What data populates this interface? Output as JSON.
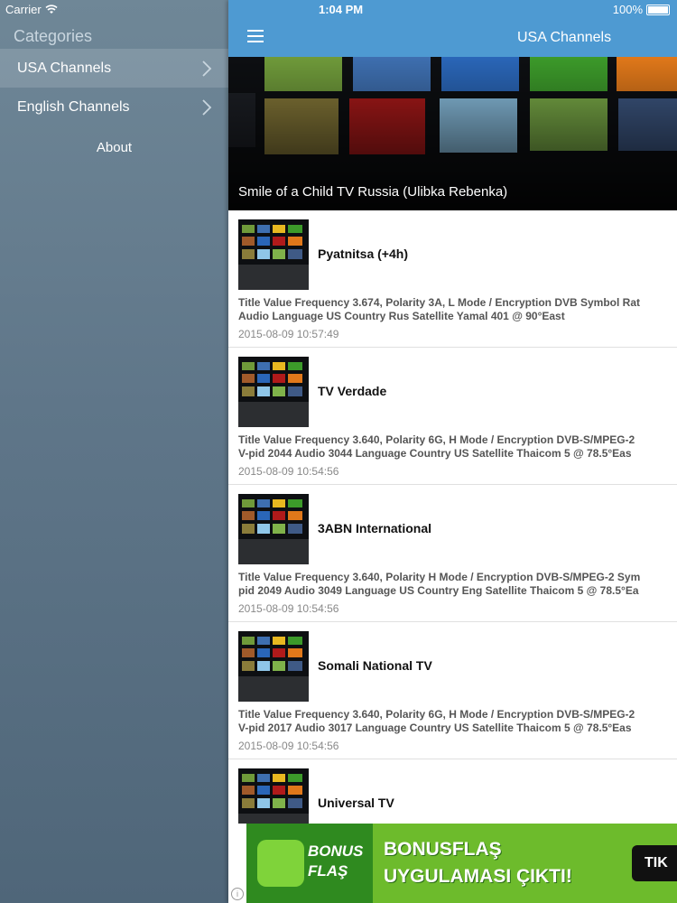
{
  "status": {
    "carrier": "Carrier",
    "time": "1:04 PM",
    "battery": "100%"
  },
  "sidebar": {
    "title": "Categories",
    "items": [
      {
        "label": "USA Channels",
        "selected": true
      },
      {
        "label": "English Channels",
        "selected": false
      }
    ],
    "about_label": "About"
  },
  "navbar": {
    "title": "USA Channels"
  },
  "hero": {
    "caption": "Smile of a Child TV Russia (Ulibka Rebenka)"
  },
  "channels": [
    {
      "title": "Pyatnitsa (+4h)",
      "desc_line1": "Title Value Frequency 3.674,  Polarity 3A, L Mode / Encryption DVB  Symbol Rat",
      "desc_line2": "Audio    Language US Country Rus Satellite Yamal 401 @ 90°East",
      "date": "2015-08-09 10:57:49"
    },
    {
      "title": "TV Verdade",
      "desc_line1": "Title Value Frequency 3.640,  Polarity 6G, H Mode / Encryption DVB-S/MPEG-2",
      "desc_line2": "V-pid 2044 Audio   3044 Language Country  US Satellite Thaicom 5 @ 78.5°Eas",
      "date": "2015-08-09 10:54:56"
    },
    {
      "title": "3ABN International",
      "desc_line1": "Title Value Frequency 3.640,  Polarity H Mode / Encryption DVB-S/MPEG-2  Sym",
      "desc_line2": "pid 2049 Audio   3049 Language US Country Eng Satellite Thaicom 5 @ 78.5°Ea",
      "date": "2015-08-09 10:54:56"
    },
    {
      "title": "Somali National TV",
      "desc_line1": "Title Value Frequency 3.640,  Polarity 6G, H Mode / Encryption DVB-S/MPEG-2",
      "desc_line2": "V-pid 2017 Audio   3017 Language Country  US Satellite Thaicom 5 @ 78.5°Eas",
      "date": "2015-08-09 10:54:56"
    },
    {
      "title": "Universal TV",
      "desc_line1": "",
      "desc_line2": "",
      "date": ""
    }
  ],
  "ad": {
    "logo_line1": "BONUS",
    "logo_line2": "FLAŞ",
    "text_line1": "BONUSFLAŞ",
    "text_line2": "UYGULAMASI ÇIKTI!",
    "button_label": "TIK",
    "info_icon": "i"
  },
  "colors": {
    "navbar": "#4e9ad2",
    "sidebar": "#5f7689",
    "ad_green": "#6dbb2c"
  }
}
